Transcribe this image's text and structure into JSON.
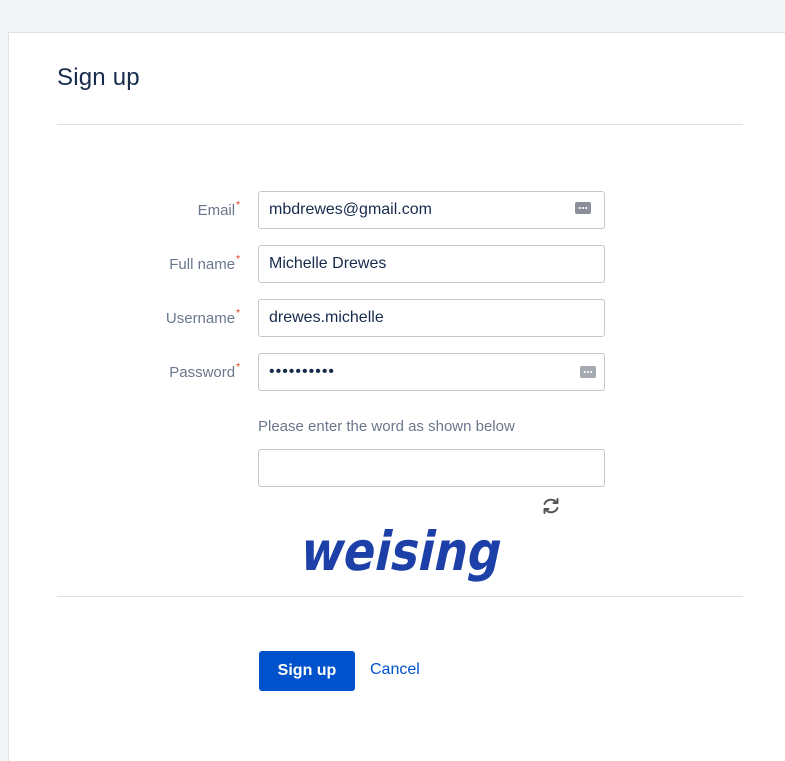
{
  "page": {
    "title": "Sign up"
  },
  "form": {
    "email": {
      "label": "Email",
      "required_mark": "*",
      "value": "mbdrewes@gmail.com"
    },
    "full_name": {
      "label": "Full name",
      "required_mark": "*",
      "value": "Michelle Drewes"
    },
    "username": {
      "label": "Username",
      "required_mark": "*",
      "value": "drewes.michelle"
    },
    "password": {
      "label": "Password",
      "required_mark": "*",
      "value": "••••••••••"
    },
    "captcha": {
      "hint": "Please enter the word as shown below",
      "value": "",
      "word": "weising"
    }
  },
  "actions": {
    "signup_label": "Sign up",
    "cancel_label": "Cancel"
  },
  "icons": {
    "password_manager": "password-manager-key-icon",
    "refresh": "refresh-icon"
  },
  "colors": {
    "primary": "#0052cc",
    "required": "#de350b",
    "captcha": "#1d3fa8"
  }
}
